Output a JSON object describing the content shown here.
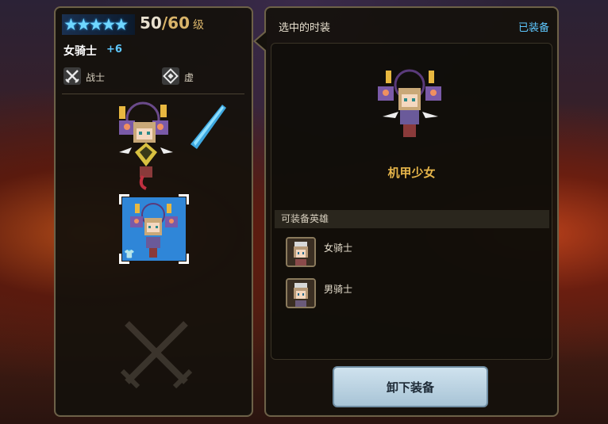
{
  "hero": {
    "stars": 5,
    "level_current": "50",
    "level_max": "60",
    "level_unit": "级",
    "name": "女骑士",
    "enhance": "+6",
    "class_label": "战士",
    "element_label": "虚"
  },
  "selected_costume": {
    "title": "选中的时装",
    "status": "已装备",
    "name": "机甲少女",
    "equippable_header": "可装备英雄",
    "heroes": [
      {
        "name": "女骑士"
      },
      {
        "name": "男骑士"
      }
    ]
  },
  "actions": {
    "unequip_label": "卸下装备"
  },
  "colors": {
    "accent_blue": "#5ec8ff",
    "gold": "#e6b54a",
    "button_bg": "#bcd4e4"
  }
}
